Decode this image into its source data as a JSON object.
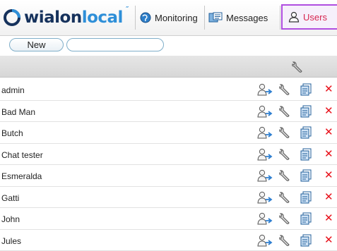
{
  "logo": {
    "text_main": "wialon",
    "text_accent": "local",
    "mark": "″"
  },
  "nav": {
    "tabs": [
      {
        "label": "Monitoring",
        "icon": "globe-icon"
      },
      {
        "label": "Messages",
        "icon": "messages-icon"
      },
      {
        "label": "Users",
        "icon": "user-icon",
        "active": true
      }
    ]
  },
  "toolbar": {
    "new_label": "New",
    "search_value": ""
  },
  "table": {
    "header_icon": "wrench-icon",
    "rows": [
      {
        "name": "admin"
      },
      {
        "name": "Bad Man"
      },
      {
        "name": "Butch"
      },
      {
        "name": "Chat tester"
      },
      {
        "name": "Esmeralda"
      },
      {
        "name": "Gatti"
      },
      {
        "name": "John"
      },
      {
        "name": "Jules"
      }
    ]
  },
  "colors": {
    "active_tab_border": "#b04ee0",
    "active_tab_text": "#d6264f",
    "delete": "#e8121c",
    "brand_dark": "#16325c",
    "brand_light": "#2e8fd8"
  }
}
